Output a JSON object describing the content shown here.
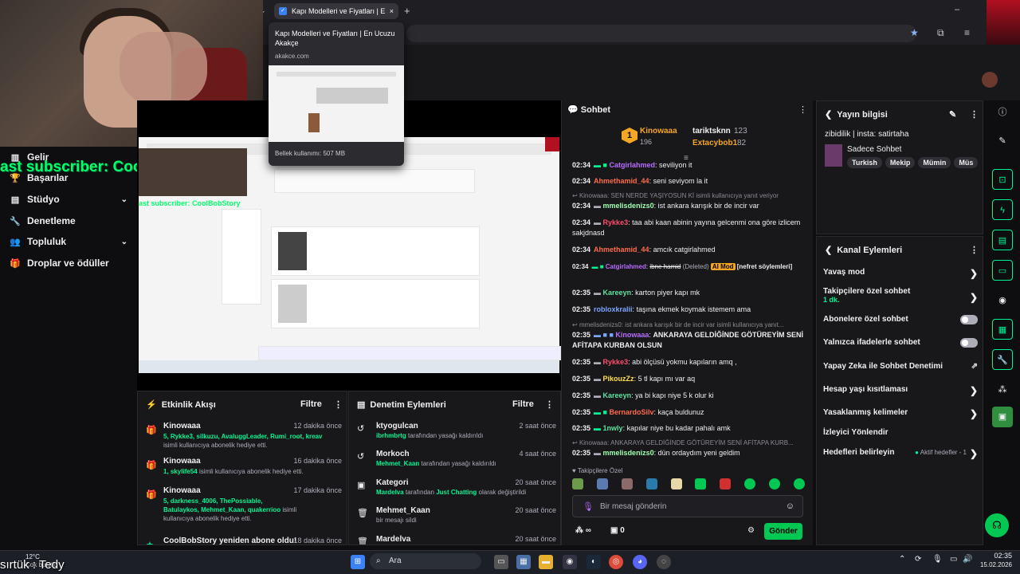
{
  "browser": {
    "tab_title": "Kapı Modelleri ve Fiyatları | En",
    "new_tab": "+",
    "close": "×",
    "preview_title": "Kapı Modelleri ve Fiyatları | En Ucuzu Akakçe",
    "preview_url": "akakce.com",
    "preview_memory": "Bellek kullanımı: 507 MB"
  },
  "overlay": {
    "subscriber_text": "ast subscriber: CoolBobStory",
    "stream_sub_text": "ast subscriber: CoolBobStory",
    "bottom_left": "sırtük : Tedy"
  },
  "leftnav": {
    "items": [
      {
        "label": "Gelir",
        "icon": "chart-icon"
      },
      {
        "label": "Başarılar",
        "icon": "trophy-icon"
      },
      {
        "label": "Stüdyo",
        "icon": "studio-icon",
        "chevron": true
      },
      {
        "label": "Denetleme",
        "icon": "wrench-icon"
      },
      {
        "label": "Topluluk",
        "icon": "people-icon",
        "chevron": true
      },
      {
        "label": "Droplar ve ödüller",
        "icon": "drops-icon"
      }
    ]
  },
  "activity": {
    "title": "Etkinlik Akışı",
    "filter": "Filtre",
    "items": [
      {
        "name": "Kinowaaa",
        "time": "12 dakika önce",
        "green": "5, Rykke3, silkuzu, AvaluggLeader, Rumi_root, kreav",
        "desc": "isimli kullanıcıya abonelik hediye etti."
      },
      {
        "name": "Kinowaaa",
        "time": "16 dakika önce",
        "green": "1, skylife54",
        "desc": "isimli kullanıcıya abonelik hediye etti."
      },
      {
        "name": "Kinowaaa",
        "time": "17 dakika önce",
        "green": "5, darkness_4006, ThePossiable, Batulaykos, Mehmet_Kaan, quakerrioo",
        "desc": "isimli kullanıcıya abonelik hediye etti."
      },
      {
        "name": "CoolBobStory yeniden abone oldu!",
        "time": "18 dakika önce"
      }
    ]
  },
  "moderation": {
    "title": "Denetim Eylemleri",
    "filter": "Filtre",
    "items": [
      {
        "name": "ktyogulcan",
        "time": "2 saat önce",
        "green": "ibrhmbrtg",
        "desc": "tarafından yasağı kaldırıldı"
      },
      {
        "name": "Morkoch",
        "time": "4 saat önce",
        "green": "Mehmet_Kaan",
        "desc": "tarafından yasağı kaldırıldı"
      },
      {
        "name": "Kategori",
        "time": "20 saat önce",
        "green": "Mardelva",
        "desc": "tarafından",
        "green2": "Just Chatting",
        "desc2": "olarak değiştirildi"
      },
      {
        "name": "Mehmet_Kaan",
        "time": "20 saat önce",
        "desc": "bir mesajı sildi"
      },
      {
        "name": "Mardelva",
        "time": "20 saat önce"
      }
    ]
  },
  "chat": {
    "title": "Sohbet",
    "top_gifters": [
      {
        "name": "Kinowaaa",
        "count": "196",
        "rank": "1"
      },
      {
        "name": "tariktsknn",
        "count": "123"
      },
      {
        "name": "Extacybob1",
        "count": "82"
      }
    ],
    "messages": [
      {
        "time": "02:34",
        "user": "Catgirlahmed",
        "color": "#b86cff",
        "text": "seviliyon it"
      },
      {
        "time": "02:34",
        "user": "Ahmethamid_44",
        "color": "#ff6b4a",
        "text": "seni seviyom la it"
      },
      {
        "reply": "Kinowaaa: SEN NERDE YAŞIYOSUN Kİ isimli kullanıcıya yanıt veriyor"
      },
      {
        "time": "02:34",
        "user": "mmelisdenizs0",
        "color": "#a0ffb0",
        "text": "ist ankara karışık bir de incir var"
      },
      {
        "time": "02:34",
        "user": "Rykke3",
        "color": "#ff4d6d",
        "text": "taa abi kaan abinin yayına gelcenmi ona göre izlicem sakjdnasd"
      },
      {
        "time": "02:34",
        "user": "Ahmethamid_44",
        "color": "#ff6b4a",
        "text": "amcık catgirlahmed"
      },
      {
        "time": "02:34",
        "user": "Catgirlahmed",
        "color": "#b86cff",
        "text": "ibne hamid",
        "deleted": "(Deleted)",
        "badge": "AI Mod",
        "extra": "[nefret söylemleri]"
      },
      {
        "time": "02:35",
        "user": "Kareeyn",
        "color": "#5be3a0",
        "text": "karton piyer kapı mk"
      },
      {
        "time": "02:35",
        "user": "robloxkralii",
        "color": "#7aa7ff",
        "text": "taşına ekmek koymak istemem ama"
      },
      {
        "reply": "mmelisdenizs0: ist ankara karışık bir de incir var isimli kullanıcıya yanıt..."
      },
      {
        "time": "02:35",
        "user": "Kinowaaa",
        "color": "#b86cff",
        "text": "ANKARAYA GELDİĞİNDE GÖTÜREYİM SENİ AFİTAPA KURBAN OLSUN"
      },
      {
        "time": "02:35",
        "user": "Rykke3",
        "color": "#ff4d6d",
        "text": "abi ölçüsü yokmu kapıların amq ,"
      },
      {
        "time": "02:35",
        "user": "PikouzZz",
        "color": "#ffe14d",
        "text": "5 tl kapı mı var aq"
      },
      {
        "time": "02:35",
        "user": "Kareeyn",
        "color": "#5be3a0",
        "text": "ya bi kapı niye 5 k olur ki"
      },
      {
        "time": "02:35",
        "user": "BernardoSilv",
        "color": "#ff6b4a",
        "text": "kaça buldunuz"
      },
      {
        "time": "02:35",
        "user": "1nwly",
        "color": "#5be3a0",
        "text": "kapılar niye bu kadar pahalı amk"
      },
      {
        "reply": "Kinowaaa: ANKARAYA GELDİĞİNDE GÖTÜREYİM SENİ AFİTAPA KURB..."
      },
      {
        "time": "02:35",
        "user": "mmelisdenizs0",
        "color": "#a0ffb0",
        "text": "dün ordaydım yeni geldim"
      }
    ],
    "emote_label": "Takipçilere Özel",
    "input_placeholder": "Bir mesaj gönderin",
    "points": "∞",
    "gifts": "0",
    "send": "Gönder"
  },
  "streaminfo": {
    "title": "Yayın bilgisi",
    "stream_title": "zibidilik | insta: satirtaha",
    "category": "Sadece Sohbet",
    "tags": [
      "Turkish",
      "Mekip",
      "Mümin",
      "Müs"
    ]
  },
  "channelactions": {
    "title": "Kanal Eylemleri",
    "rows": [
      {
        "label": "Yavaş mod",
        "kind": "arrow"
      },
      {
        "label": "Takipçilere özel sohbet",
        "sub": "1 dk.",
        "kind": "arrow"
      },
      {
        "label": "Abonelere özel sohbet",
        "kind": "toggle"
      },
      {
        "label": "Yalnızca ifadelerle sohbet",
        "kind": "toggle"
      },
      {
        "label": "Yapay Zeka ile Sohbet Denetimi",
        "kind": "ext"
      },
      {
        "label": "Hesap yaşı kısıtlaması",
        "kind": "arrow"
      },
      {
        "label": "Yasaklanmış kelimeler",
        "kind": "arrow"
      },
      {
        "label": "İzleyici Yönlendir",
        "kind": "none"
      },
      {
        "label": "Hedefleri belirleyin",
        "kind": "goal",
        "goal": "Aktif hedefler - 1"
      }
    ]
  },
  "taskbar": {
    "weather_temp": "12°C",
    "weather_desc": "Çok bulutlu",
    "search": "Ara",
    "time": "02:35",
    "date": "15.02.2026"
  }
}
